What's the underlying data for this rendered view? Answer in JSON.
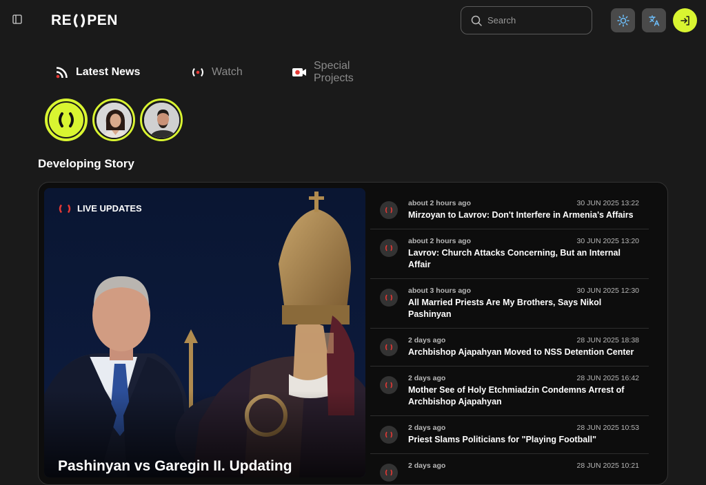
{
  "header": {
    "logo_left": "RE",
    "logo_right": "PEN",
    "search_placeholder": "Search"
  },
  "tabs": [
    {
      "label": "Latest News",
      "active": true
    },
    {
      "label": "Watch",
      "active": false
    },
    {
      "label": "Special Projects",
      "active": false
    }
  ],
  "section_title": "Developing Story",
  "hero": {
    "badge": "LIVE UPDATES",
    "title": "Pashinyan vs Garegin II. Updating"
  },
  "news": [
    {
      "ago": "about 2 hours ago",
      "date": "30 JUN 2025 13:22",
      "headline": "Mirzoyan to Lavrov: Don't Interfere in Armenia's Affairs"
    },
    {
      "ago": "about 2 hours ago",
      "date": "30 JUN 2025 13:20",
      "headline": "Lavrov: Church Attacks Concerning, But an Internal Affair"
    },
    {
      "ago": "about 3 hours ago",
      "date": "30 JUN 2025 12:30",
      "headline": "All Married Priests Are My Brothers, Says Nikol Pashinyan"
    },
    {
      "ago": "2 days ago",
      "date": "28 JUN 2025 18:38",
      "headline": "Archbishop Ajapahyan Moved to NSS Detention Center"
    },
    {
      "ago": "2 days ago",
      "date": "28 JUN 2025 16:42",
      "headline": "Mother See of Holy Etchmiadzin Condemns Arrest of Archbishop Ajapahyan"
    },
    {
      "ago": "2 days ago",
      "date": "28 JUN 2025 10:53",
      "headline": "Priest Slams Politicians for \"Playing Football\""
    },
    {
      "ago": "2 days ago",
      "date": "28 JUN 2025 10:21",
      "headline": ""
    }
  ],
  "colors": {
    "accent": "#d9f531",
    "live_red": "#e53935",
    "background": "#1a1a1a"
  }
}
